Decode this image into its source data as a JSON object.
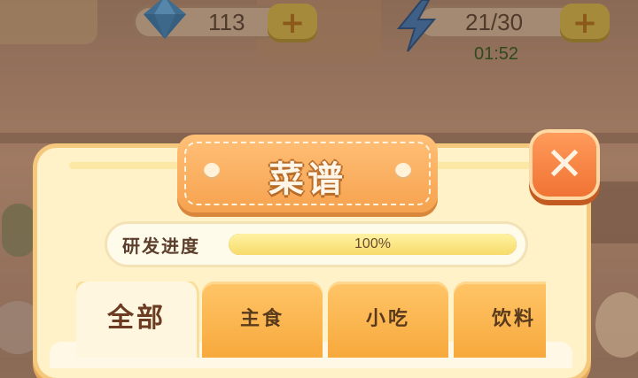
{
  "hud": {
    "gems": {
      "icon": "diamond-icon",
      "value": "113",
      "plus": "+"
    },
    "energy": {
      "icon": "lightning-icon",
      "value": "21/30",
      "plus": "+",
      "timer": "01:52"
    }
  },
  "dialog": {
    "title": "菜谱",
    "close_icon": "close-icon",
    "progress": {
      "label": "研发进度",
      "fraction": 1.0,
      "text": "100%"
    },
    "tabs": [
      {
        "label": "全部",
        "active": true
      },
      {
        "label": "主食",
        "active": false
      },
      {
        "label": "小吃",
        "active": false
      },
      {
        "label": "饮料",
        "active": false
      }
    ]
  },
  "colors": {
    "accent": "#f6a24e",
    "panel": "#fff2c8",
    "close": "#f07334"
  }
}
